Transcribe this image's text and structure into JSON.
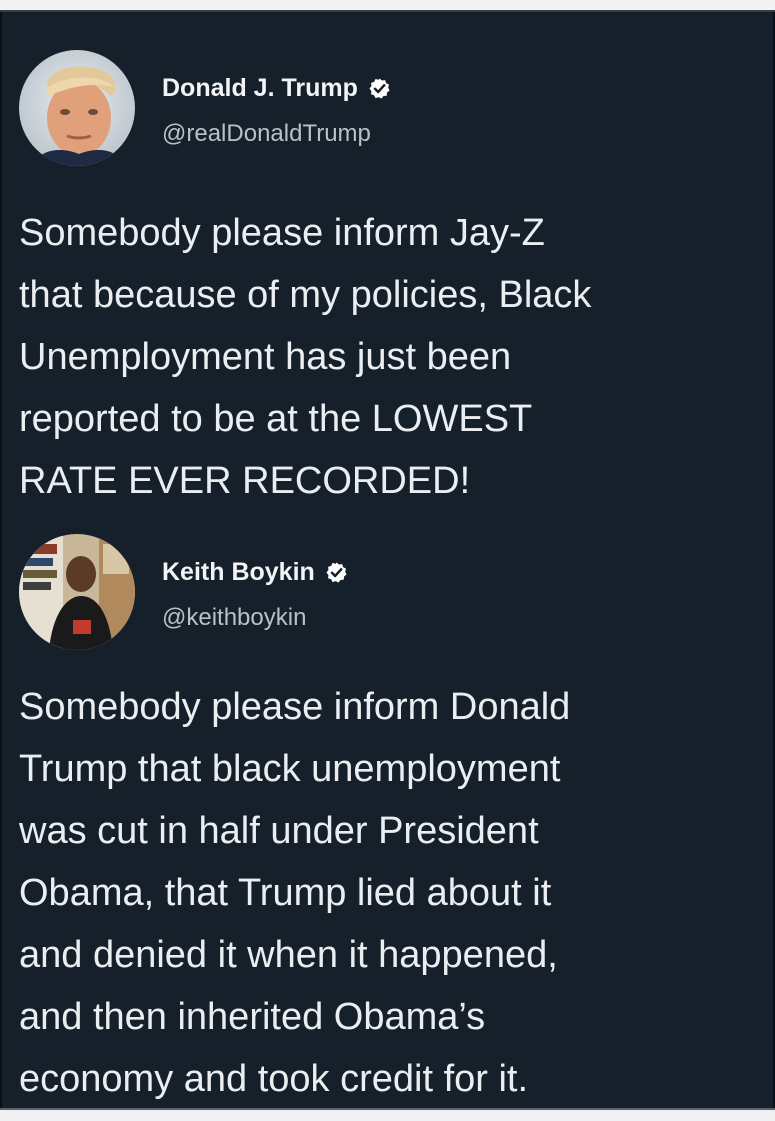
{
  "tweets": [
    {
      "author": {
        "display_name": "Donald J. Trump",
        "handle": "@realDonaldTrump",
        "verified": true,
        "avatar_icon": "profile-photo-icon"
      },
      "text": "Somebody please inform Jay-Z\nthat because of my policies, Black\nUnemployment has just been\nreported to be at the LOWEST\nRATE EVER RECORDED!"
    },
    {
      "author": {
        "display_name": "Keith Boykin",
        "handle": "@keithboykin",
        "verified": true,
        "avatar_icon": "profile-photo-icon"
      },
      "text": "Somebody please inform Donald\nTrump that black unemployment\nwas cut in half under President\nObama, that Trump lied about it\nand denied it when it happened,\nand then inherited Obama’s\neconomy and took credit for it."
    }
  ],
  "colors": {
    "background": "#16202b",
    "text": "#ebeef1",
    "handle": "#b8c0c8",
    "verified_badge": "#ffffff"
  }
}
